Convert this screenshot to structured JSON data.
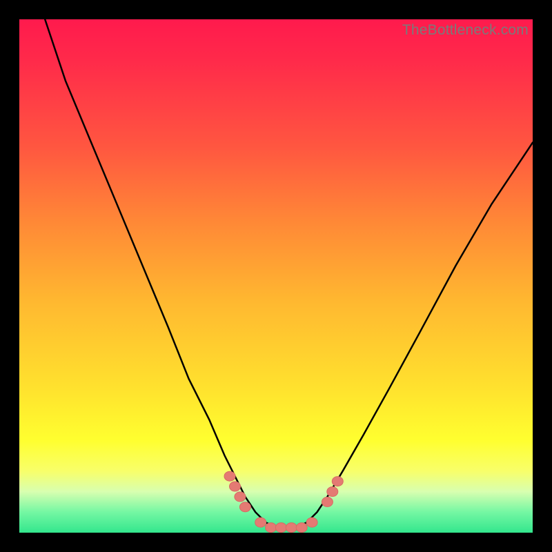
{
  "watermark": "TheBottleneck.com",
  "colors": {
    "page_bg": "#000000",
    "gradient_top": "#ff1a4d",
    "gradient_bottom": "#33e68d",
    "curve": "#000000",
    "dots": "#e47a73"
  },
  "chart_data": {
    "type": "line",
    "title": "",
    "xlabel": "",
    "ylabel": "",
    "xlim": [
      0,
      100
    ],
    "ylim": [
      0,
      100
    ],
    "grid": false,
    "legend": false,
    "series": [
      {
        "name": "curve",
        "x": [
          5,
          9,
          14,
          19,
          24,
          29,
          33,
          37,
          40,
          42,
          44,
          46,
          48,
          50,
          52,
          54,
          56,
          58,
          60,
          63,
          67,
          72,
          78,
          85,
          92,
          100
        ],
        "y": [
          100,
          88,
          76,
          64,
          52,
          40,
          30,
          22,
          15,
          11,
          7,
          4,
          2,
          1,
          1,
          1,
          2,
          4,
          7,
          12,
          19,
          28,
          39,
          52,
          64,
          76
        ]
      }
    ],
    "markers": [
      {
        "name": "left-cluster",
        "x": [
          41,
          42,
          43,
          44
        ],
        "y": [
          11,
          9,
          7,
          5
        ]
      },
      {
        "name": "flat-cluster",
        "x": [
          47,
          49,
          51,
          53,
          55,
          57
        ],
        "y": [
          2,
          1,
          1,
          1,
          1,
          2
        ]
      },
      {
        "name": "right-cluster",
        "x": [
          60,
          61,
          62
        ],
        "y": [
          6,
          8,
          10
        ]
      }
    ]
  }
}
